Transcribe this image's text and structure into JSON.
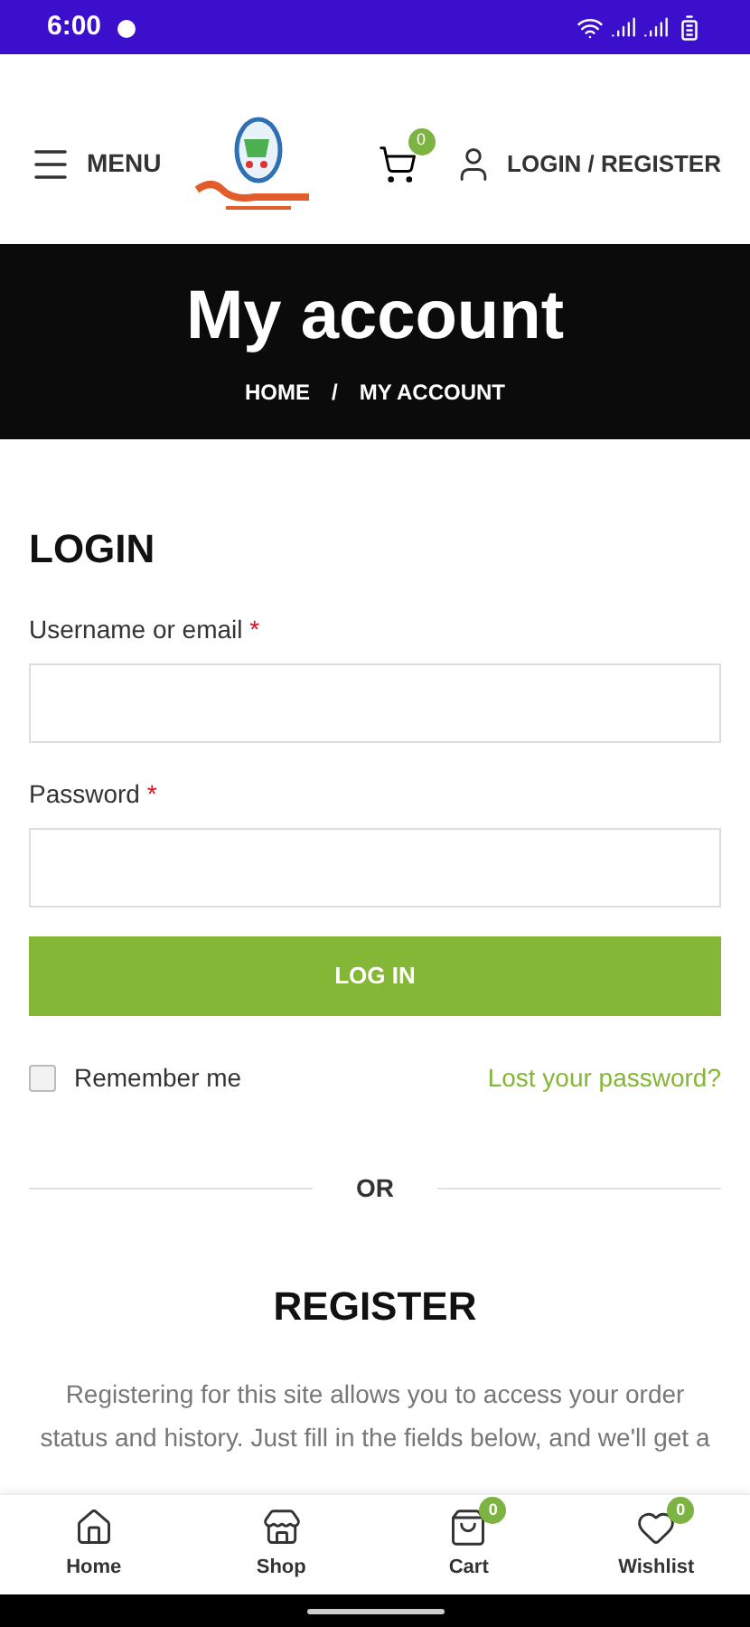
{
  "status_bar": {
    "time": "6:00"
  },
  "header": {
    "menu_label": "MENU",
    "cart_count": "0",
    "account_label": "LOGIN / REGISTER"
  },
  "banner": {
    "title": "My account",
    "breadcrumbs": [
      {
        "label": "HOME"
      },
      {
        "label": "MY ACCOUNT"
      }
    ],
    "separator": "/"
  },
  "login": {
    "title": "LOGIN",
    "fields": [
      {
        "label": "Username or email",
        "required_mark": "*"
      },
      {
        "label": "Password",
        "required_mark": "*"
      }
    ],
    "button": "LOG IN",
    "remember": {
      "label": "Remember me",
      "checked": false
    },
    "lost_password": "Lost your password?"
  },
  "divider": "OR",
  "register": {
    "title": "REGISTER",
    "text": "Registering for this site allows you to access your order status and history. Just fill in the fields below, and we'll get a"
  },
  "bottom_nav": [
    {
      "kind": "home",
      "label": "Home"
    },
    {
      "kind": "shop",
      "label": "Shop"
    },
    {
      "kind": "cart",
      "label": "Cart",
      "count": "0"
    },
    {
      "kind": "wishlist",
      "label": "Wishlist",
      "count": "0"
    }
  ]
}
